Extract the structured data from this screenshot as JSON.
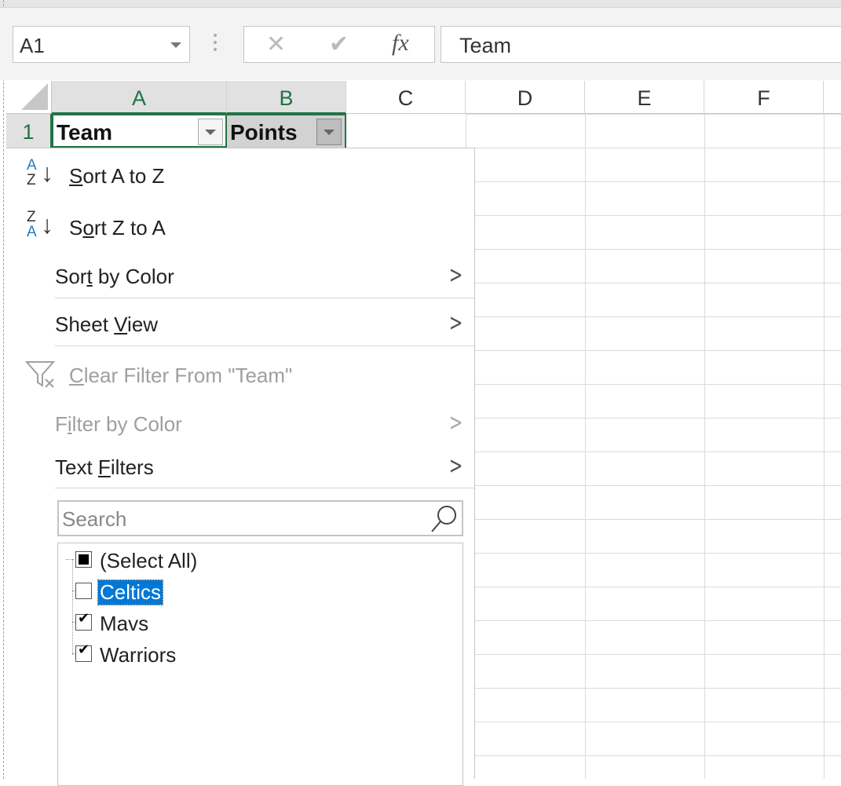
{
  "formula_bar": {
    "name_box": "A1",
    "cancel_icon": "✕",
    "enter_icon": "✔",
    "fx_label": "fx",
    "formula_value": "Team"
  },
  "columns": [
    "A",
    "B",
    "C",
    "D",
    "E",
    "F"
  ],
  "rows": [
    "1"
  ],
  "cells": {
    "A1": "Team",
    "B1": "Points"
  },
  "filter_menu": {
    "sort_a_z": {
      "prefix": "",
      "underline": "S",
      "rest": "ort A to Z"
    },
    "sort_z_a": {
      "prefix": "S",
      "underline": "o",
      "rest": "rt Z to A"
    },
    "sort_by_color": {
      "prefix": "Sor",
      "underline": "t",
      "rest": " by Color"
    },
    "sheet_view": {
      "prefix": "Sheet ",
      "underline": "V",
      "rest": "iew"
    },
    "clear_filter": {
      "prefix": "",
      "underline": "C",
      "rest": "lear Filter From \"Team\""
    },
    "filter_by_color": {
      "prefix": "F",
      "underline": "i",
      "rest": "lter by Color"
    },
    "text_filters": {
      "prefix": "Text ",
      "underline": "F",
      "rest": "ilters"
    },
    "search_placeholder": "Search",
    "items": [
      {
        "label": "(Select All)",
        "state": "indeterminate"
      },
      {
        "label": "Celtics",
        "state": "unchecked",
        "highlighted": true
      },
      {
        "label": "Mavs",
        "state": "checked"
      },
      {
        "label": "Warriors",
        "state": "checked"
      }
    ]
  },
  "colors": {
    "accent_green": "#217346",
    "selection_blue": "#0078d7",
    "sort_icon_blue": "#1e7bc4"
  }
}
